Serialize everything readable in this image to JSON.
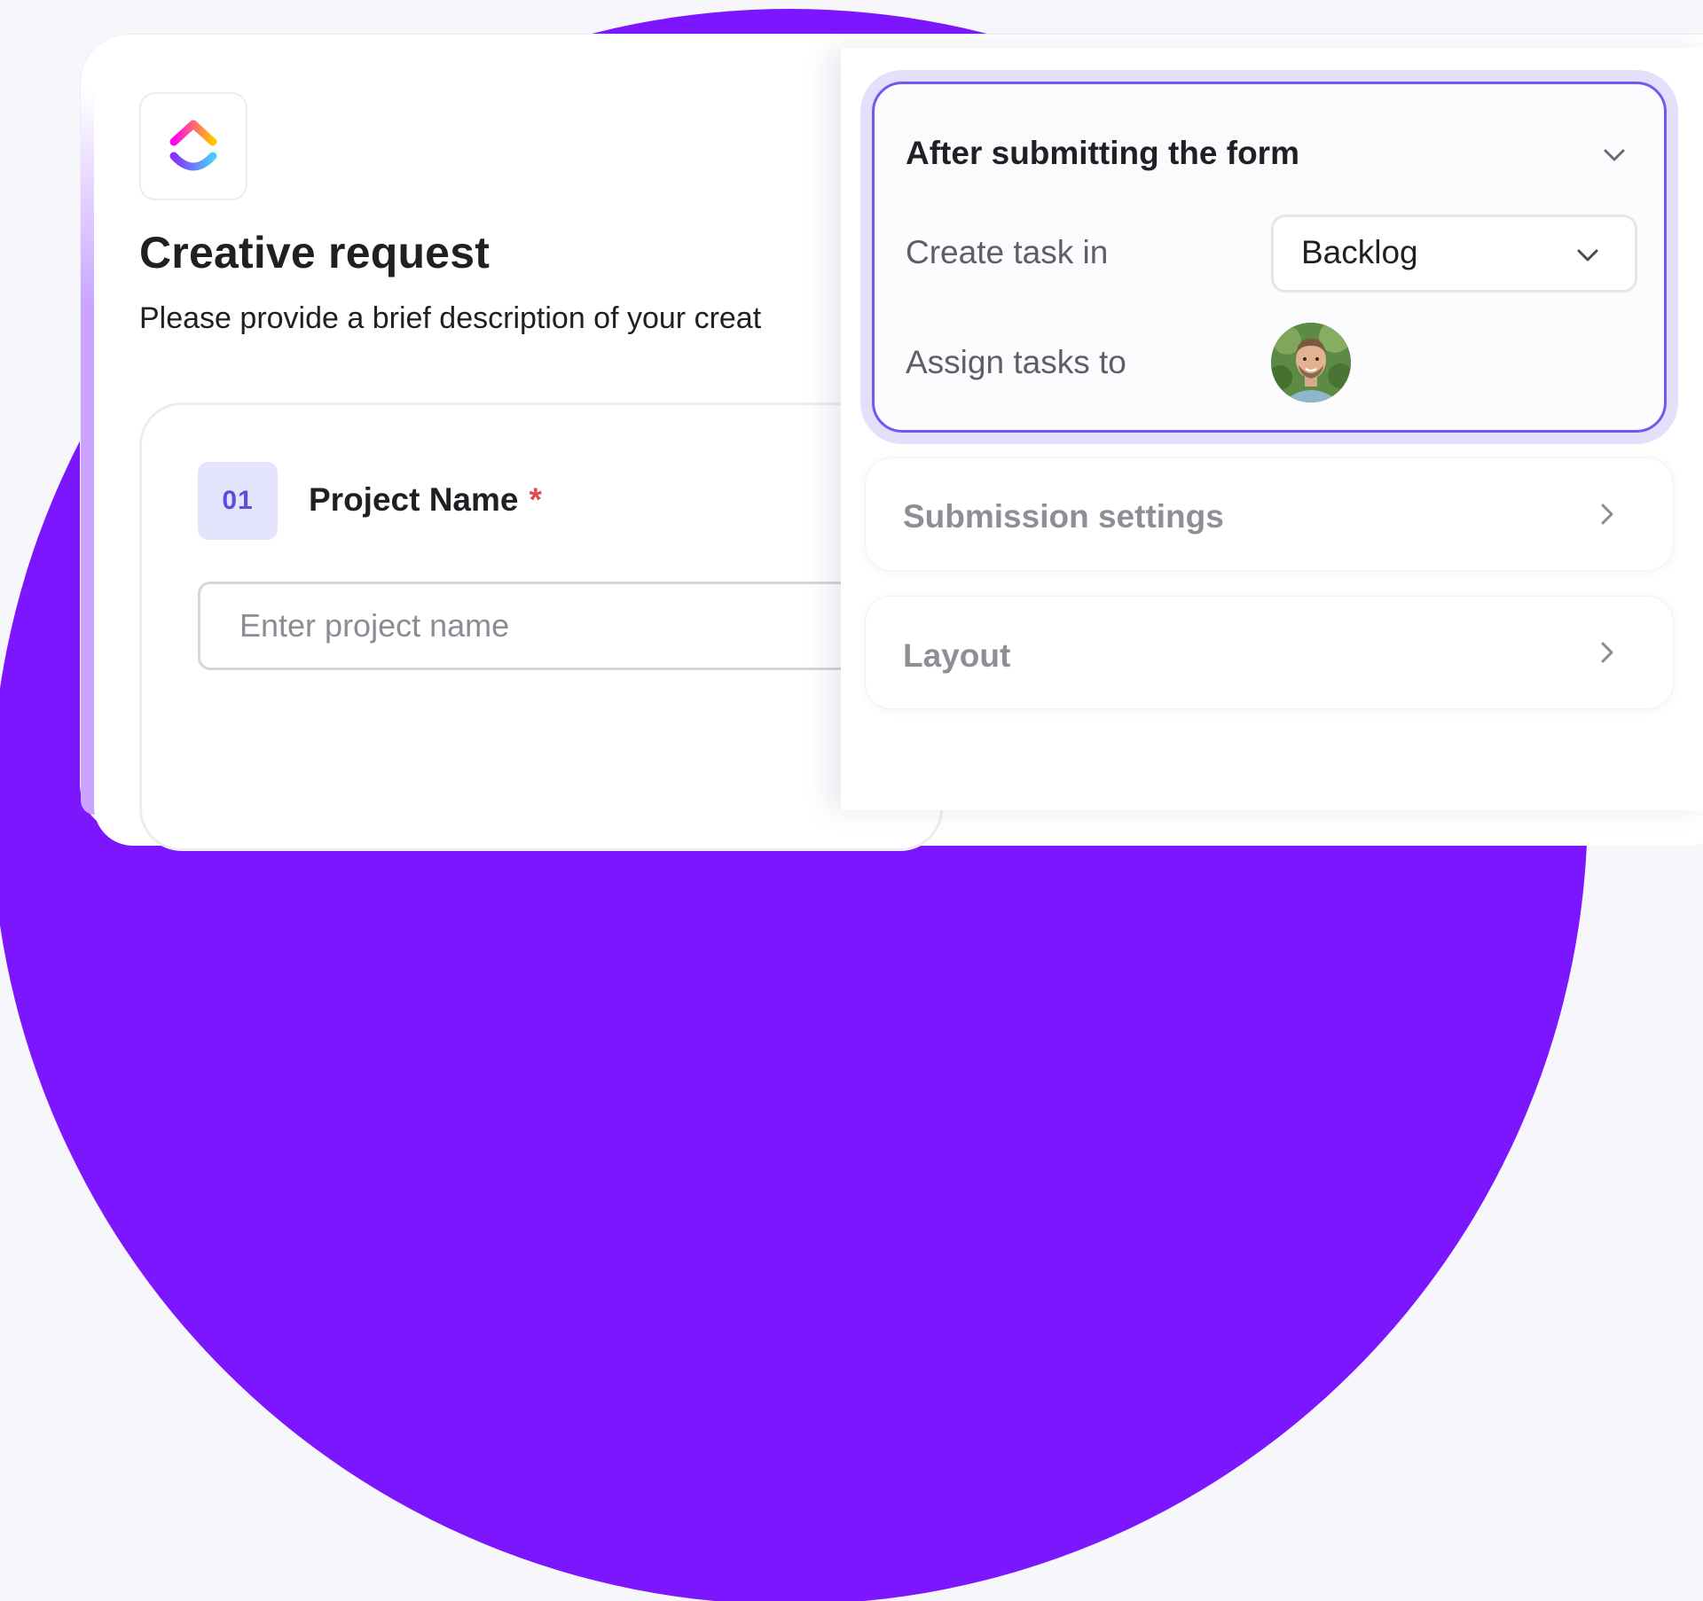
{
  "form": {
    "title": "Creative request",
    "description": "Please provide a brief description of your creat",
    "question": {
      "number": "01",
      "label": "Project Name",
      "required_mark": "*",
      "placeholder": "Enter project name"
    }
  },
  "settings_panel": {
    "active_section": {
      "title": "After submitting the form",
      "create_task_label": "Create task in",
      "create_task_value": "Backlog",
      "assign_label": "Assign tasks to"
    },
    "sections": [
      {
        "title": "Submission settings"
      },
      {
        "title": "Layout"
      }
    ]
  },
  "colors": {
    "brand_purple": "#7b16ff",
    "accent": "#6b5cf0",
    "required": "#e5484d"
  },
  "icons": [
    "clickup-logo-icon",
    "chevron-down-icon",
    "chevron-right-icon"
  ]
}
